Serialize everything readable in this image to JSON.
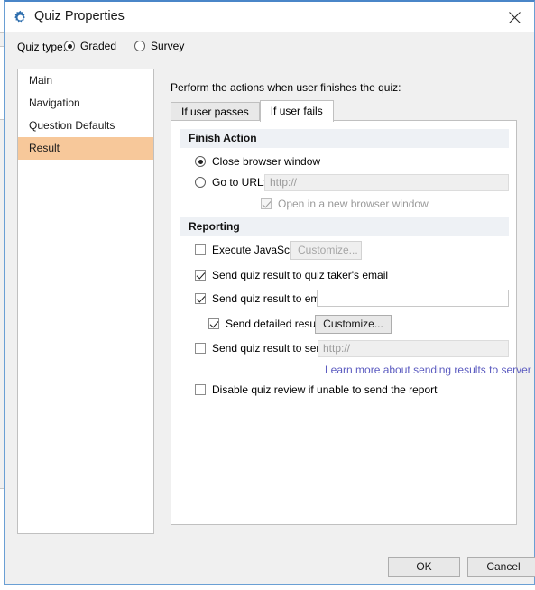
{
  "window": {
    "title": "Quiz Properties",
    "icon": "gear-icon",
    "close_icon": "close-icon",
    "accent_border": "#4a86c8"
  },
  "quiz_type": {
    "label": "Quiz type:",
    "options": [
      {
        "label": "Graded",
        "selected": true
      },
      {
        "label": "Survey",
        "selected": false
      }
    ]
  },
  "sidebar": {
    "items": [
      {
        "label": "Main",
        "selected": false
      },
      {
        "label": "Navigation",
        "selected": false
      },
      {
        "label": "Question Defaults",
        "selected": false
      },
      {
        "label": "Result",
        "selected": true
      }
    ],
    "selected_color": "#f7c89a"
  },
  "main": {
    "intro": "Perform the actions when user finishes the quiz:",
    "tabs": [
      {
        "label": "If user passes",
        "active": false
      },
      {
        "label": "If user fails",
        "active": true
      }
    ],
    "finish_action": {
      "heading": "Finish Action",
      "close_window": {
        "label": "Close browser window",
        "selected": true
      },
      "go_to_url": {
        "label": "Go to URL:",
        "selected": false,
        "url_placeholder": "http://",
        "url_value": ""
      },
      "open_new_window": {
        "label": "Open in a new browser window",
        "checked": true,
        "disabled": true
      }
    },
    "reporting": {
      "heading": "Reporting",
      "execute_javascript": {
        "label": "Execute JavaScript",
        "checked": false,
        "button_label": "Customize...",
        "button_disabled": true
      },
      "send_to_taker_email": {
        "label": "Send quiz result to quiz taker's email",
        "checked": true
      },
      "send_to_email": {
        "label": "Send quiz result to email",
        "checked": true,
        "value": "",
        "placeholder": ""
      },
      "send_detailed_results": {
        "label": "Send detailed results",
        "checked": true,
        "button_label": "Customize...",
        "button_disabled": false
      },
      "send_to_server": {
        "label": "Send quiz result to server",
        "checked": false,
        "url_placeholder": "http://",
        "url_value": ""
      },
      "learn_more_link": {
        "label": "Learn more about sending results to server",
        "color": "#5b5bc0"
      },
      "disable_quiz_review": {
        "label": "Disable quiz review if unable to send the report",
        "checked": false
      }
    }
  },
  "footer": {
    "ok_label": "OK",
    "cancel_label": "Cancel"
  }
}
